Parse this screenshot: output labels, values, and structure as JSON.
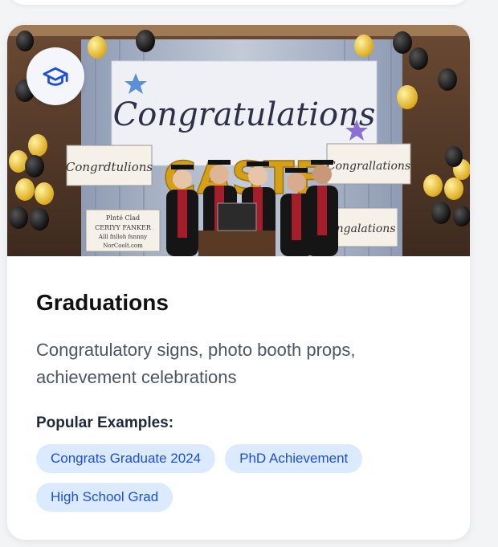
{
  "card": {
    "icon": "graduation-cap-icon",
    "title": "Graduations",
    "description": "Congratulatory signs, photo booth props, achievement celebrations",
    "examples_heading": "Popular Examples:",
    "examples": [
      "Congrats Graduate 2024",
      "PhD Achievement",
      "High School Grad"
    ],
    "accent_color": "#1d4ed8",
    "tag_background": "#dbeafe"
  },
  "photo": {
    "banner_text": "Congratulations",
    "balloon_letters": "CASTE",
    "sign_left": "Congrdtulions",
    "sign_right_top": "Congrallations",
    "sign_right_bottom": "Congalations",
    "sign_small": [
      "Plnté Clad",
      "CERIYY FANKER",
      "Alll fnlloh fsnnny",
      "NorCoolt.com"
    ]
  }
}
